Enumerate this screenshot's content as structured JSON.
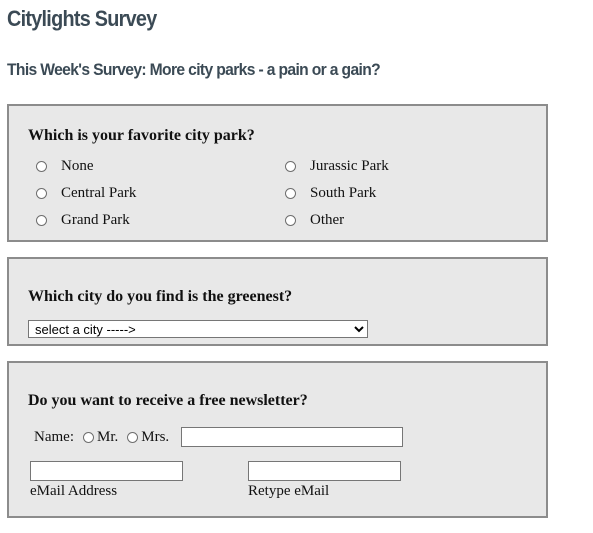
{
  "site": {
    "title": "Citylights Survey"
  },
  "survey": {
    "heading": "This Week's Survey: More city parks - a pain or a gain?"
  },
  "park_question": {
    "question": "Which is your favorite city park?",
    "options": [
      "None",
      "Central Park",
      "Grand Park",
      "Jurassic Park",
      "South Park",
      "Other"
    ]
  },
  "city_question": {
    "question": "Which city do you find is the greenest?",
    "select": {
      "selected": "select a city ----->"
    }
  },
  "newsletter": {
    "question": "Do you want to receive a free newsletter?",
    "name_label": "Name:",
    "title_options": [
      "Mr.",
      "Mrs."
    ],
    "name_value": "",
    "email_label": "eMail Address",
    "email_value": "",
    "retype_label": "Retype eMail",
    "retype_value": ""
  }
}
